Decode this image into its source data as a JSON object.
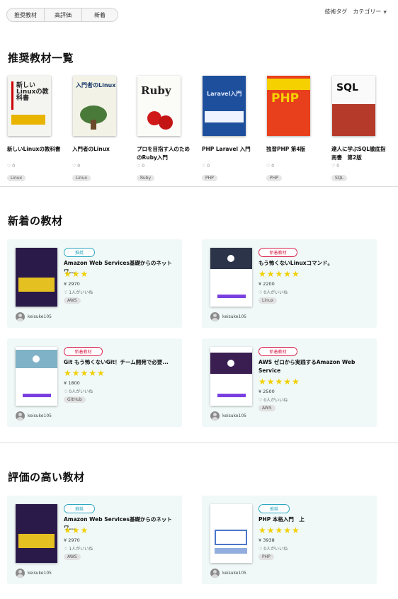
{
  "filters": {
    "tabs": [
      "推奨教材",
      "高評価",
      "新着"
    ],
    "tech_tag": "技術タグ",
    "category": "カテゴリー"
  },
  "sections": {
    "recommended": "推奨教材一覧",
    "newest": "新着の教材",
    "top_rated": "評価の高い教材"
  },
  "recommended": [
    {
      "title": "新しいLinuxの教科書",
      "likes": "♡ 0",
      "tag": "Linux",
      "cover_text": "新しいLinuxの教科書"
    },
    {
      "title": "入門者のLinux",
      "likes": "♡ 0",
      "tag": "Linux",
      "cover_text": "入門者のLinux"
    },
    {
      "title": "プロを目指す人のためのRuby入門",
      "likes": "♡ 0",
      "tag": "Ruby",
      "cover_text": "Ruby"
    },
    {
      "title": "PHP Laravel 入門",
      "likes": "♡ 0",
      "tag": "PHP",
      "cover_text": "Laravel入門"
    },
    {
      "title": "独習PHP 第4版",
      "likes": "♡ 0",
      "tag": "PHP",
      "cover_text": "PHP"
    },
    {
      "title": "達人に学ぶSQL徹底指南書　第2版",
      "likes": "♡ 0",
      "tag": "SQL",
      "cover_text": "SQL"
    }
  ],
  "newest": [
    {
      "badge": "推奨",
      "badge_type": "rec",
      "title": "Amazon Web Services基礎からのネットワ...",
      "stars": "★★★",
      "price": "¥ 2970",
      "likes": "♡ 1人がいいね",
      "tag": "AWS",
      "user": "keisuke105"
    },
    {
      "badge": "新着教材",
      "badge_type": "new",
      "title": "もう怖くないLinuxコマンド。",
      "stars": "★★★★★",
      "price": "¥ 2200",
      "likes": "♡ 0人がいいね",
      "tag": "Linux",
      "user": "keisuke105"
    },
    {
      "badge": "新着教材",
      "badge_type": "new",
      "title": "Git もう怖くないGit！チーム開発で必要...",
      "stars": "★★★★★",
      "price": "¥ 1800",
      "likes": "♡ 0人がいいね",
      "tag": "GitHub",
      "user": "keisuke105"
    },
    {
      "badge": "新着教材",
      "badge_type": "new",
      "title": "AWS ゼロから実践するAmazon Web Service",
      "stars": "★★★★★",
      "price": "¥ 2500",
      "likes": "♡ 0人がいいね",
      "tag": "AWS",
      "user": "keisuke105"
    }
  ],
  "top_rated": [
    {
      "badge": "推奨",
      "badge_type": "rec",
      "title": "Amazon Web Services基礎からのネットワ...",
      "stars": "★★★",
      "price": "¥ 2970",
      "likes": "♡ 1人がいいね",
      "tag": "AWS",
      "user": "keisuke105"
    },
    {
      "badge": "推奨",
      "badge_type": "rec",
      "title": "PHP 本格入門　上",
      "stars": "★★★★★",
      "price": "¥ 3938",
      "likes": "♡ 0人がいいね",
      "tag": "PHP",
      "user": "keisuke105"
    }
  ],
  "colors": {
    "card_bg": "#f0f8f8",
    "star": "#f0d000",
    "recommend_badge": "#2ea7c0",
    "new_badge": "#d9254e"
  }
}
